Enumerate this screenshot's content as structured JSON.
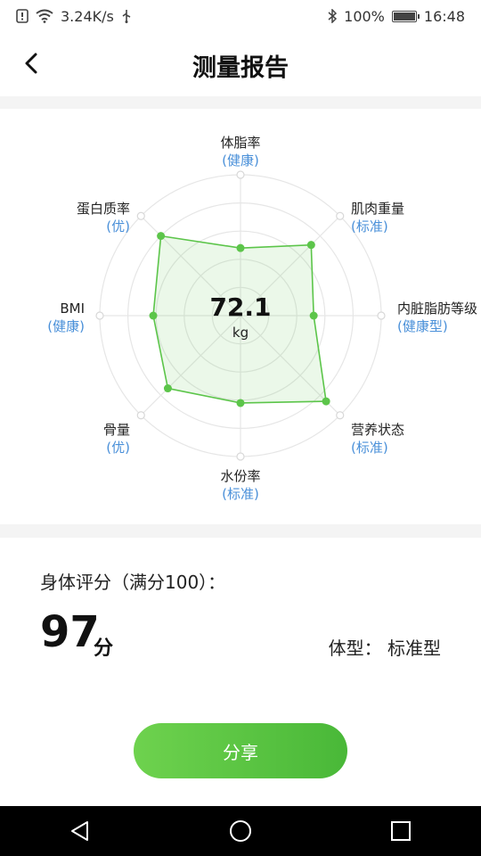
{
  "status_bar": {
    "speed": "3.24K/s",
    "battery": "100%",
    "time": "16:48"
  },
  "header": {
    "title": "测量报告",
    "back_icon": "chevron-left-icon"
  },
  "radar": {
    "center_value": "72.1",
    "center_unit": "kg",
    "rings": 5,
    "accent_color": "#5cc54a",
    "axes": [
      {
        "name": "体脂率",
        "status": "(健康)",
        "value": 0.48
      },
      {
        "name": "肌肉重量",
        "status": "(标准)",
        "value": 0.71
      },
      {
        "name": "内脏脂肪等级",
        "status": "(健康型)",
        "value": 0.52
      },
      {
        "name": "营养状态",
        "status": "(标准)",
        "value": 0.86
      },
      {
        "name": "水份率",
        "status": "(标准)",
        "value": 0.62
      },
      {
        "name": "骨量",
        "status": "(优)",
        "value": 0.73
      },
      {
        "name": "BMI",
        "status": "(健康)",
        "value": 0.62
      },
      {
        "name": "蛋白质率",
        "status": "(优)",
        "value": 0.8
      }
    ]
  },
  "score": {
    "title": "身体评分（满分100）：",
    "value": "97",
    "unit": "分",
    "body_type": "体型：  标准型"
  },
  "share_button": {
    "label": "分享"
  },
  "nav_bar": {
    "back_icon": "triangle-back-icon",
    "home_icon": "circle-home-icon",
    "recents_icon": "square-recents-icon"
  }
}
